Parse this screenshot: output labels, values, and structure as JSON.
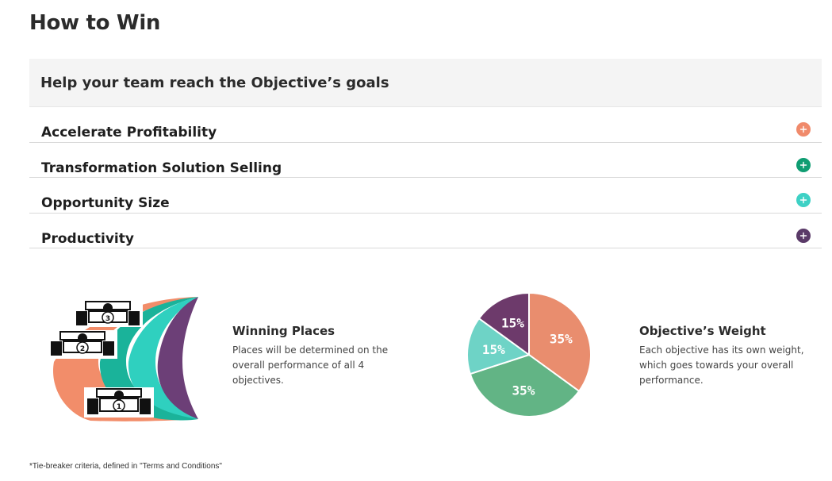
{
  "page": {
    "title": "How to Win"
  },
  "banner": {
    "title": "Help your team reach the Objective’s goals"
  },
  "objectives": [
    {
      "label": "Accelerate Profitability",
      "color": "#f08a6b",
      "toggle_icon": "plus-icon"
    },
    {
      "label": "Transformation Solution Selling",
      "color": "#0f9d72",
      "toggle_icon": "plus-icon"
    },
    {
      "label": "Opportunity Size",
      "color": "#3ed1c5",
      "toggle_icon": "plus-icon"
    },
    {
      "label": "Productivity",
      "color": "#5a3a68",
      "toggle_icon": "plus-icon"
    }
  ],
  "winning_places": {
    "title": "Winning Places",
    "description": "Places will be determined on the overall performance of all 4 objectives.",
    "podium_places": [
      "3",
      "2",
      "1"
    ],
    "icon": "race-cars-podium-icon"
  },
  "objective_weight": {
    "title": "Objective’s Weight",
    "description": "Each objective has its own weight, which goes towards your overall performance."
  },
  "chart_data": {
    "type": "pie",
    "values": [
      35,
      35,
      15,
      15
    ],
    "labels": [
      "35%",
      "35%",
      "15%",
      "15%"
    ],
    "colors": [
      "#e98d6e",
      "#62b485",
      "#6ed3c6",
      "#6d3a6b"
    ],
    "legend": "none"
  },
  "footnote": "*Tie-breaker criteria, defined in \"Terms and Conditions\""
}
